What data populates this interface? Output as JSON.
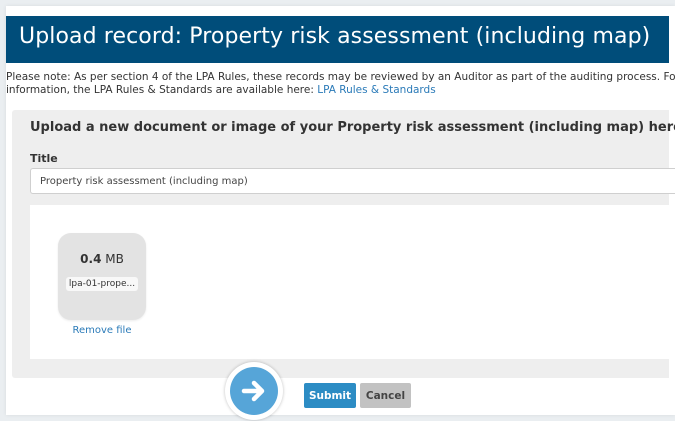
{
  "header": {
    "title": "Upload record: Property risk assessment (including map)"
  },
  "notice": {
    "line1": "Please note: As per section 4 of the LPA Rules, these records may be reviewed by an Auditor as part of the auditing process. For mo",
    "line2": "information, the LPA Rules & Standards are available here:",
    "link": "LPA Rules & Standards"
  },
  "upload": {
    "heading": "Upload a new document or image of your Property risk assessment (including map) here",
    "title_label": "Title",
    "title_value": "Property risk assessment (including map)"
  },
  "file": {
    "size_value": "0.4",
    "size_unit": "MB",
    "name": "lpa-01-prope...",
    "remove_label": "Remove file"
  },
  "actions": {
    "arrow_icon": "arrow-right-icon",
    "submit_label": "Submit",
    "cancel_label": "Cancel"
  },
  "colors": {
    "header_bg": "#004d7a",
    "link": "#2a7ab8",
    "submit_bg": "#2c8cc4",
    "cancel_bg": "#c2c2c2",
    "arrow_bg": "#56a5d8"
  }
}
